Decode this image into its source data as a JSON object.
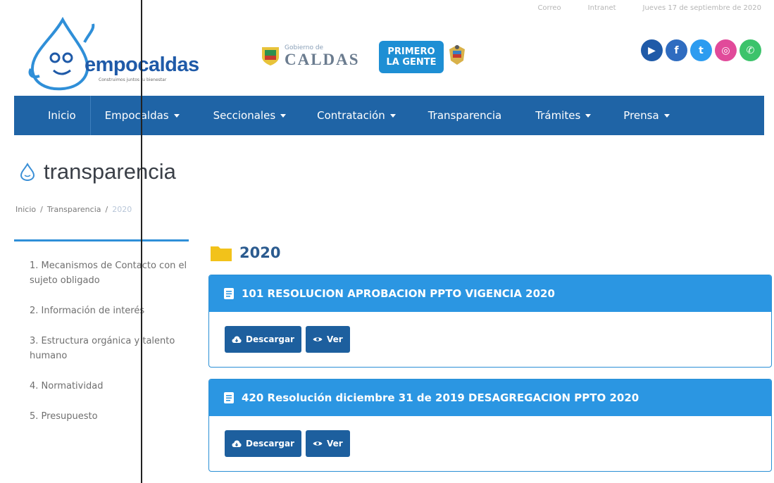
{
  "topbar": {
    "links": [
      "Correo",
      "Intranet"
    ],
    "date": "Jueves 17 de septiembre de 2020"
  },
  "brand": {
    "name": "empocaldas",
    "tagline": "Construimos juntos tu bienestar",
    "gobierno_small": "Gobierno de",
    "gobierno_big": "CALDAS",
    "primero_line1": "PRIMERO",
    "primero_line2": "LA GENTE"
  },
  "social": [
    {
      "name": "video-icon",
      "glyph": "▶",
      "color": "#1f5aa8"
    },
    {
      "name": "facebook-icon",
      "glyph": "f",
      "color": "#2f6cc0"
    },
    {
      "name": "twitter-icon",
      "glyph": "t",
      "color": "#2d9cf0"
    },
    {
      "name": "instagram-icon",
      "glyph": "◎",
      "color": "#e14a9a"
    },
    {
      "name": "whatsapp-icon",
      "glyph": "✆",
      "color": "#3cc36b"
    }
  ],
  "nav": {
    "items": [
      {
        "label": "Inicio",
        "dropdown": false
      },
      {
        "label": "Empocaldas",
        "dropdown": true
      },
      {
        "label": "Seccionales",
        "dropdown": true
      },
      {
        "label": "Contratación",
        "dropdown": true
      },
      {
        "label": "Transparencia",
        "dropdown": false
      },
      {
        "label": "Trámites",
        "dropdown": true
      },
      {
        "label": "Prensa",
        "dropdown": true
      }
    ]
  },
  "page": {
    "title": "transparencia",
    "breadcrumb": [
      "Inicio",
      "/",
      "Transparencia",
      "/",
      "2020"
    ]
  },
  "sidebar": {
    "items": [
      "1. Mecanismos de Contacto con el sujeto obligado",
      "2. Información de interés",
      "3. Estructura orgánica y talento humano",
      "4. Normatividad",
      "5. Presupuesto"
    ]
  },
  "main": {
    "folder": "2020",
    "documents": [
      {
        "title": "101 RESOLUCION APROBACION PPTO VIGENCIA 2020",
        "download": "Descargar",
        "view": "Ver"
      },
      {
        "title": "420 Resolución diciembre 31 de 2019 DESAGREGACION PPTO 2020",
        "download": "Descargar",
        "view": "Ver"
      }
    ]
  },
  "colors": {
    "nav": "#1f64a6",
    "card_header": "#2b96e2",
    "button": "#1d5f9e",
    "folder": "#f2c21a"
  }
}
